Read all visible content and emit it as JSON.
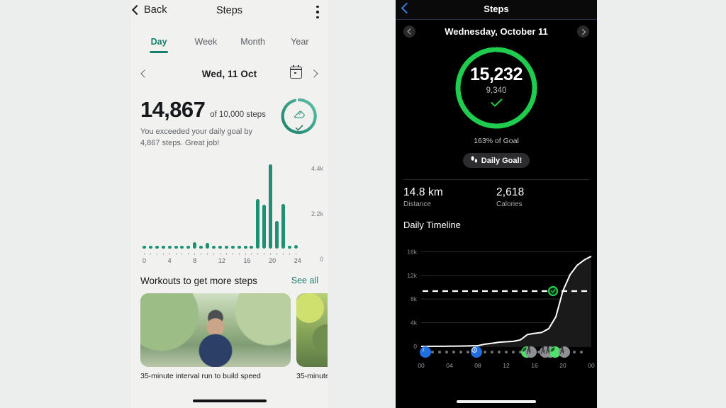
{
  "left": {
    "topbar": {
      "back_label": "Back",
      "title": "Steps",
      "menu_icon": "kebab-menu-icon"
    },
    "tabs": [
      {
        "label": "Day",
        "active": true
      },
      {
        "label": "Week",
        "active": false
      },
      {
        "label": "Month",
        "active": false
      },
      {
        "label": "Year",
        "active": false
      }
    ],
    "datebar": {
      "prev_icon": "chevron-left-icon",
      "date": "Wed, 11 Oct",
      "calendar_icon": "calendar-icon",
      "next_icon": "chevron-right-icon"
    },
    "summary": {
      "steps": "14,867",
      "goal_text": "of 10,000 steps",
      "message": "You exceeded your daily goal by 4,867 steps. Great job!",
      "gauge_icon": "shoe-icon",
      "gauge_check_icon": "check-icon",
      "accent": "#17806a"
    },
    "workouts": {
      "title": "Workouts to get more steps",
      "see_all": "See all"
    },
    "cards": [
      {
        "caption": "35-minute interval run to build speed"
      },
      {
        "caption": "35-minute"
      }
    ],
    "chart_data": {
      "type": "bar",
      "title": "Steps per hour",
      "xlabel": "",
      "ylabel": "",
      "ylim": [
        0,
        4400
      ],
      "yticks": [
        0,
        2200,
        4400
      ],
      "ytick_labels": [
        "0",
        "2.2k",
        "4.4k"
      ],
      "grid": false,
      "bar_color": "#1f9074",
      "categories": [
        "0",
        "1",
        "2",
        "3",
        "4",
        "5",
        "6",
        "7",
        "8",
        "9",
        "10",
        "11",
        "12",
        "13",
        "14",
        "15",
        "16",
        "17",
        "18",
        "19",
        "20",
        "21",
        "22",
        "23",
        "24"
      ],
      "xtick_labels": [
        "0",
        "",
        "",
        "",
        "4",
        "",
        "",
        "",
        "8",
        "",
        "",
        "",
        "12",
        "",
        "",
        "",
        "16",
        "",
        "",
        "",
        "20",
        "",
        "",
        "",
        "24"
      ],
      "values": [
        60,
        0,
        0,
        55,
        55,
        0,
        0,
        0,
        330,
        60,
        290,
        60,
        60,
        60,
        60,
        0,
        90,
        60,
        2520,
        2250,
        4270,
        1400,
        2280,
        60,
        160
      ]
    }
  },
  "right": {
    "topbar": {
      "back_icon": "chevron-left-icon",
      "title": "Steps"
    },
    "datebar": {
      "prev_icon": "chevron-left-circle-icon",
      "date": "Wednesday, October 11",
      "next_icon": "chevron-right-circle-icon"
    },
    "ring": {
      "steps": "15,232",
      "secondary": "9,340",
      "check_icon": "check-icon",
      "percent_of_goal": "163% of Goal",
      "color": "#1fcc4d",
      "progress": 0.93
    },
    "pill": {
      "label": "Daily Goal!",
      "icon": "footprints-icon"
    },
    "stats": [
      {
        "value": "14.8 km",
        "label": "Distance"
      },
      {
        "value": "2,618",
        "label": "Calories"
      }
    ],
    "timeline_title": "Daily Timeline",
    "chart_data": {
      "type": "line",
      "title": "Daily Timeline",
      "xlabel": "",
      "ylabel": "",
      "ylim": [
        0,
        17000
      ],
      "yticks": [
        0,
        4000,
        8000,
        12000,
        16000
      ],
      "ytick_labels": [
        "0",
        "4k",
        "8k",
        "12k",
        "16k"
      ],
      "xtick_labels": [
        "00",
        "04",
        "08",
        "12",
        "16",
        "20",
        "00"
      ],
      "grid": true,
      "goal_line": 9340,
      "goal_marker_hour": 18.6,
      "line_color": "#ffffff",
      "marker_color": "#1fcc4d",
      "x": [
        0,
        1,
        2,
        3,
        4,
        5,
        6,
        7,
        8,
        9,
        10,
        11,
        12,
        13,
        14,
        15,
        16,
        17,
        18,
        19,
        20,
        21,
        22,
        23,
        24
      ],
      "values": [
        0,
        0,
        10,
        20,
        30,
        40,
        60,
        90,
        120,
        380,
        520,
        700,
        780,
        850,
        1100,
        2000,
        2200,
        2350,
        3000,
        5000,
        9400,
        12100,
        13700,
        14600,
        15232
      ]
    },
    "activity_strip": [
      {
        "hour": 0.6,
        "type": "badge",
        "icon": "sleep-icon",
        "color": "#1f6fe0"
      },
      {
        "hour": 1.6,
        "type": "dot"
      },
      {
        "hour": 2.6,
        "type": "dot"
      },
      {
        "hour": 3.6,
        "type": "dot"
      },
      {
        "hour": 4.6,
        "type": "dot"
      },
      {
        "hour": 5.6,
        "type": "dot"
      },
      {
        "hour": 6.6,
        "type": "dot"
      },
      {
        "hour": 7.8,
        "type": "badge",
        "icon": "workout-ring-icon",
        "color": "#1f6fe0"
      },
      {
        "hour": 9.0,
        "type": "dot"
      },
      {
        "hour": 10.0,
        "type": "dot"
      },
      {
        "hour": 11.0,
        "type": "dot"
      },
      {
        "hour": 12.0,
        "type": "dot"
      },
      {
        "hour": 13.0,
        "type": "dot"
      },
      {
        "hour": 14.0,
        "type": "dot"
      },
      {
        "hour": 14.9,
        "type": "badge",
        "icon": "leaf-icon",
        "color": "#4ee06a"
      },
      {
        "hour": 15.5,
        "type": "badge",
        "icon": "walking-icon",
        "color": "#8e9194"
      },
      {
        "hour": 16.6,
        "type": "dot"
      },
      {
        "hour": 17.5,
        "type": "badge",
        "icon": "walking-icon",
        "color": "#8e9194"
      },
      {
        "hour": 18.2,
        "type": "badge",
        "icon": "walking-icon",
        "color": "#8e9194"
      },
      {
        "hour": 18.9,
        "type": "badge",
        "icon": "leaf-icon",
        "color": "#4ee06a"
      },
      {
        "hour": 20.2,
        "type": "badge",
        "icon": "walking-icon",
        "color": "#8e9194"
      },
      {
        "hour": 21.6,
        "type": "dot"
      },
      {
        "hour": 22.6,
        "type": "dot"
      }
    ]
  }
}
